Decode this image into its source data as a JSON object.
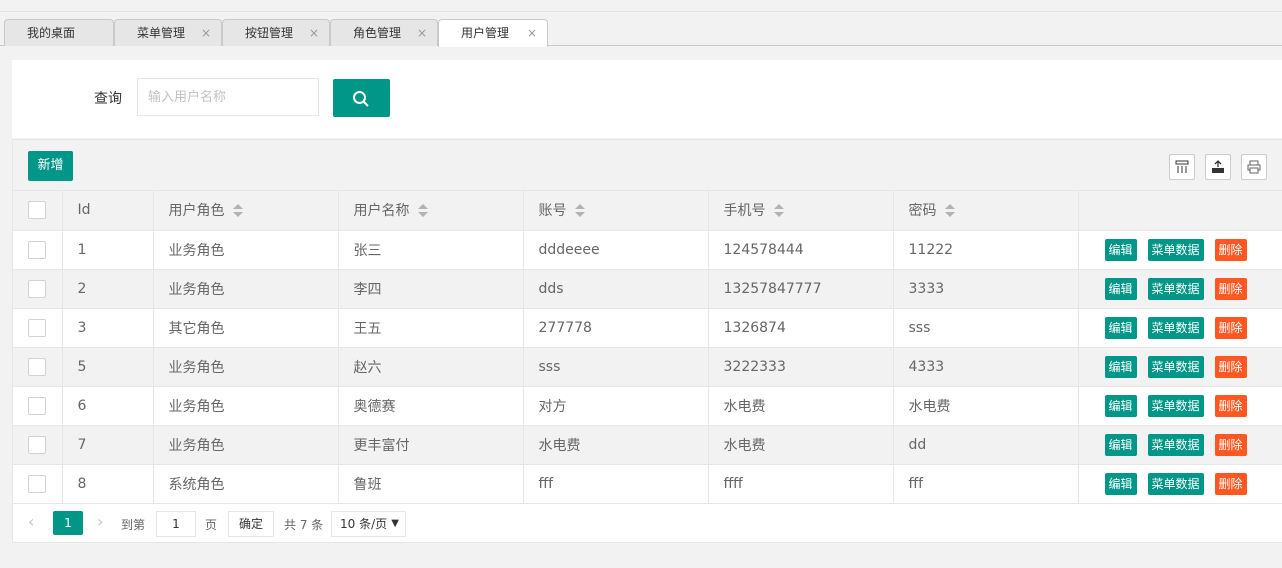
{
  "tabs": [
    {
      "label": "我的桌面",
      "closable": false
    },
    {
      "label": "菜单管理",
      "closable": true
    },
    {
      "label": "按钮管理",
      "closable": true
    },
    {
      "label": "角色管理",
      "closable": true
    },
    {
      "label": "用户管理",
      "closable": true,
      "active": true
    }
  ],
  "tab_close_glyph": "×",
  "search": {
    "label": "查询",
    "placeholder": "输入用户名称",
    "button_icon": "search-icon"
  },
  "toolbar": {
    "add_label": "新增",
    "icons": [
      "columns-icon",
      "export-icon",
      "print-icon"
    ]
  },
  "table": {
    "columns": [
      "Id",
      "用户角色",
      "用户名称",
      "账号",
      "手机号",
      "密码"
    ],
    "rows": [
      [
        "1",
        "业务角色",
        "张三",
        "dddeeee",
        "124578444",
        "11222"
      ],
      [
        "2",
        "业务角色",
        "李四",
        "dds",
        "13257847777",
        "3333"
      ],
      [
        "3",
        "其它角色",
        "王五",
        "277778",
        "1326874",
        "sss"
      ],
      [
        "5",
        "业务角色",
        "赵六",
        "sss",
        "3222333",
        "4333"
      ],
      [
        "6",
        "业务角色",
        "奥德赛",
        "对方",
        "水电费",
        "水电费"
      ],
      [
        "7",
        "业务角色",
        "更丰富付",
        "水电费",
        "水电费",
        "dd"
      ],
      [
        "8",
        "系统角色",
        "鲁班",
        "fff",
        "ffff",
        "fff"
      ]
    ],
    "actions": [
      "编辑",
      "菜单数据",
      "删除"
    ]
  },
  "pager": {
    "current": "1",
    "goto_label": "到第",
    "page_value": "1",
    "page_unit": "页",
    "confirm_label": "确定",
    "total_text": "共 7 条",
    "page_size": "10 条/页"
  },
  "colors": {
    "primary": "#009688",
    "danger": "#ff5722"
  }
}
